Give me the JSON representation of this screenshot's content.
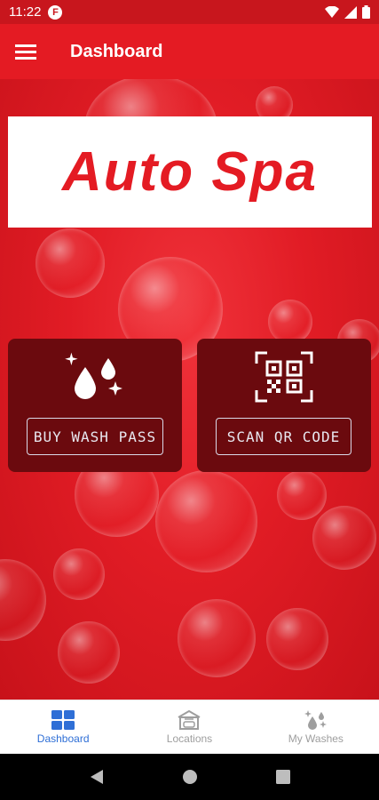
{
  "status_bar": {
    "time": "11:22",
    "notification_icon": "F"
  },
  "app_bar": {
    "title": "Dashboard"
  },
  "logo": {
    "text": "Auto Spa"
  },
  "cards": {
    "buy": {
      "label": "BUY WASH PASS"
    },
    "scan": {
      "label": "SCAN QR CODE"
    }
  },
  "bottom_nav": {
    "items": [
      {
        "label": "Dashboard",
        "icon": "dashboard-grid-icon",
        "active": true
      },
      {
        "label": "Locations",
        "icon": "car-wash-building-icon",
        "active": false
      },
      {
        "label": "My Washes",
        "icon": "water-drops-sparkle-icon",
        "active": false
      }
    ]
  },
  "colors": {
    "primary": "#e41b23",
    "card": "#6b0a0e",
    "nav_active": "#2f6fd6",
    "nav_inactive": "#9e9e9e"
  }
}
